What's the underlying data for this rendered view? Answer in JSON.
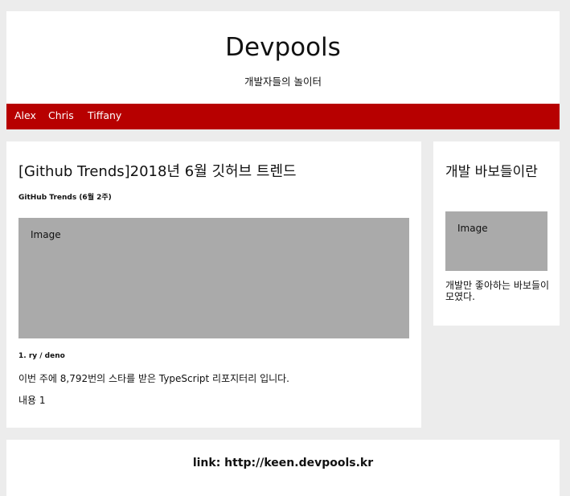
{
  "header": {
    "title": "Devpools",
    "subtitle": "개발자들의 놀이터"
  },
  "nav": {
    "links": [
      "Alex",
      "Chris",
      "Tiffany"
    ]
  },
  "post": {
    "title": "[Github Trends]2018년 6월 깃허브 트렌드",
    "subtitle": "GitHub Trends (6월 2주)",
    "image_label": "Image",
    "section_heading": "1. ry / deno",
    "paragraph1": "이번 주에 8,792번의 스타를 받은 TypeScript 리포지터리 입니다.",
    "paragraph2": "내용 1"
  },
  "sidebar": {
    "title": "개발 바보들이란",
    "image_label": "Image",
    "text": "개발만 좋아하는 바보들이 모였다."
  },
  "footer": {
    "link_text": "link: http://keen.devpools.kr"
  },
  "colors": {
    "nav_background": "#b70000",
    "page_background": "#ececec",
    "placeholder": "#aaaaaa"
  }
}
